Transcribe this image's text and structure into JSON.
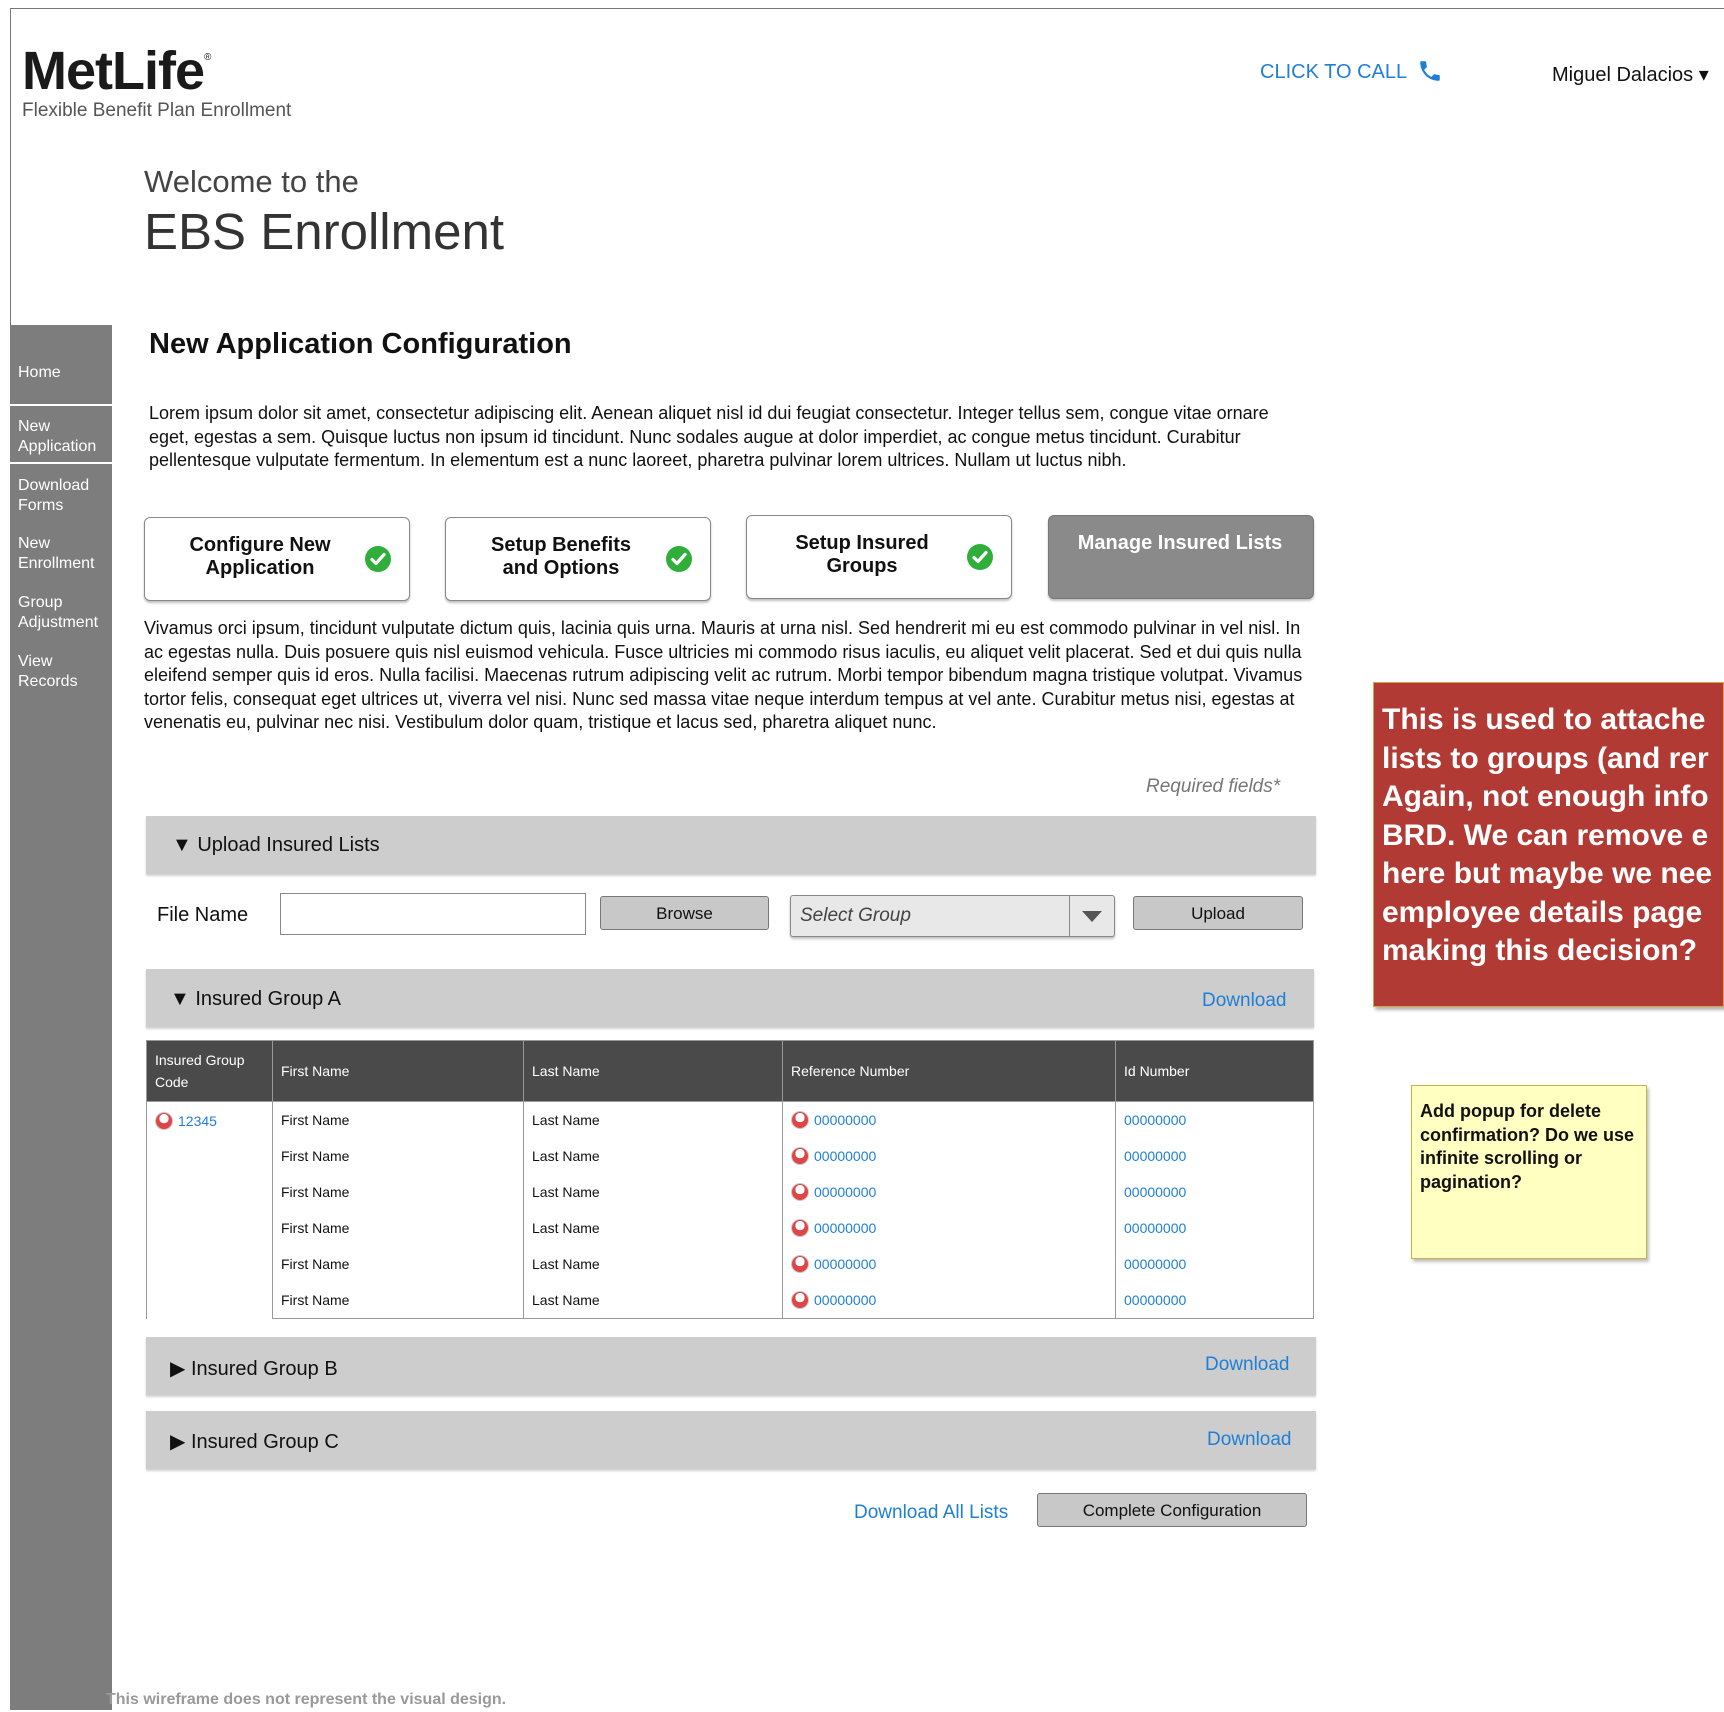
{
  "header": {
    "logo_text": "MetLife",
    "logo_mark": "®",
    "tagline": "Flexible Benefit Plan Enrollment",
    "call_label": "CLICK TO CALL",
    "call_icon": "phone-icon",
    "user_name": "Miguel Dalacios ▾"
  },
  "welcome": {
    "line1": "Welcome to the",
    "line2": "EBS Enrollment"
  },
  "sidebar": {
    "items": [
      {
        "label": "Home"
      },
      {
        "label": "New Application"
      },
      {
        "label": "Download Forms"
      },
      {
        "label": "New Enrollment"
      },
      {
        "label": "Group Adjustment"
      },
      {
        "label": "View Records"
      }
    ]
  },
  "main": {
    "title": "New Application Configuration",
    "intro": "Lorem ipsum dolor sit amet, consectetur adipiscing elit. Aenean aliquet nisl id dui feugiat consectetur. Integer tellus sem, congue vitae ornare eget, egestas a sem. Quisque luctus non ipsum id tincidunt. Nunc sodales augue at dolor imperdiet, ac congue metus tincidunt. Curabitur pellentesque vulputate fermentum. In elementum est a nunc laoreet, pharetra pulvinar lorem ultrices. Nullam ut luctus nibh.",
    "steps": [
      {
        "label": "Configure New Application",
        "done": true
      },
      {
        "label": "Setup Benefits and Options",
        "done": true
      },
      {
        "label": "Setup Insured Groups",
        "done": true
      },
      {
        "label": "Manage Insured Lists",
        "done": false
      }
    ],
    "body": "Vivamus orci ipsum, tincidunt vulputate dictum quis, lacinia quis urna. Mauris at urna nisl. Sed hendrerit mi eu est commodo pulvinar in vel nisl. In ac egestas nulla. Duis posuere quis nisl euismod vehicula. Fusce ultricies mi commodo risus iaculis, eu aliquet velit placerat. Sed et dui quis nulla eleifend semper quis id eros. Nulla facilisi. Maecenas rutrum adipiscing velit ac rutrum. Morbi tempor bibendum magna tristique volutpat. Vivamus tortor felis, consequat eget ultrices ut, viverra vel nisi. Nunc sed massa vitae neque interdum tempus at vel ante. Curabitur metus nisi, egestas at venenatis eu, pulvinar nec nisi. Vestibulum dolor quam, tristique et lacus sed, pharetra aliquet nunc.",
    "required_note": "Required fields*",
    "upload": {
      "title": "▼ Upload Insured Lists",
      "file_label": "File Name",
      "file_value": "",
      "browse_label": "Browse",
      "select_placeholder": "Select Group",
      "upload_label": "Upload"
    },
    "group_a": {
      "title": "▼ Insured Group A",
      "download_label": "Download",
      "columns": [
        "Insured Group Code",
        "First Name",
        "Last Name",
        "Reference Number",
        "Id Number"
      ],
      "group_code": "12345",
      "rows": [
        {
          "first": "First Name",
          "last": "Last Name",
          "ref": "00000000",
          "id": "00000000"
        },
        {
          "first": "First Name",
          "last": "Last Name",
          "ref": "00000000",
          "id": "00000000"
        },
        {
          "first": "First Name",
          "last": "Last Name",
          "ref": "00000000",
          "id": "00000000"
        },
        {
          "first": "First Name",
          "last": "Last Name",
          "ref": "00000000",
          "id": "00000000"
        },
        {
          "first": "First Name",
          "last": "Last Name",
          "ref": "00000000",
          "id": "00000000"
        },
        {
          "first": "First Name",
          "last": "Last Name",
          "ref": "00000000",
          "id": "00000000"
        }
      ]
    },
    "group_b": {
      "title": "▶ Insured Group B",
      "download_label": "Download"
    },
    "group_c": {
      "title": "▶ Insured Group C",
      "download_label": "Download"
    },
    "download_all_label": "Download All Lists",
    "complete_label": "Complete Configuration"
  },
  "notes": {
    "red": [
      "This is used to attache",
      "lists to groups (and rer",
      "Again, not enough info",
      "BRD. We can remove e",
      "here but maybe we nee",
      "employee details page",
      "making this decision?"
    ],
    "yellow": "Add popup for delete confirmation? Do we use infinite scrolling or pagination?"
  },
  "footer": "This wireframe does not represent the visual design.",
  "colors": {
    "link": "#1f7fd6",
    "sidebar": "#7d7d7d",
    "check": "#2fae3a",
    "note_red": "#b23a34",
    "note_yellow": "#ffffc2"
  }
}
